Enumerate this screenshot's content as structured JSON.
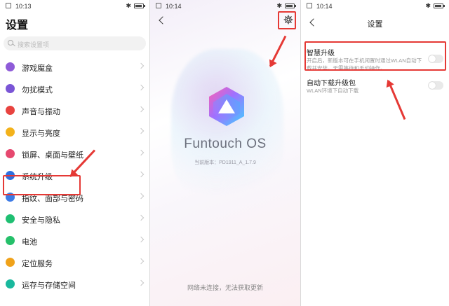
{
  "panel1": {
    "status_time": "10:13",
    "title": "设置",
    "search_placeholder": "搜索设置项",
    "items": [
      {
        "label": "游戏魔盒",
        "icon": "gamepad-icon",
        "color": "#8e5bd8"
      },
      {
        "label": "勿扰模式",
        "icon": "moon-icon",
        "color": "#7a55d6"
      },
      {
        "label": "声音与振动",
        "icon": "speaker-icon",
        "color": "#e8433f"
      },
      {
        "label": "显示与亮度",
        "icon": "sun-icon",
        "color": "#f3b21b"
      },
      {
        "label": "锁屏、桌面与壁纸",
        "icon": "shirt-icon",
        "color": "#e6486f"
      },
      {
        "label": "系统升级",
        "icon": "upgrade-icon",
        "color": "#2f6fe0"
      },
      {
        "label": "指纹、面部与密码",
        "icon": "fingerprint-icon",
        "color": "#3d7be6"
      },
      {
        "label": "安全与隐私",
        "icon": "shield-icon",
        "color": "#1fbf72"
      },
      {
        "label": "电池",
        "icon": "battery-icon",
        "color": "#25c06a"
      },
      {
        "label": "定位服务",
        "icon": "location-pin-icon",
        "color": "#f0a21a"
      },
      {
        "label": "运存与存储空间",
        "icon": "storage-icon",
        "color": "#19b89d"
      }
    ]
  },
  "panel2": {
    "status_time": "10:14",
    "brand": "Funtouch OS",
    "version": "当前版本：PD1911_A_1.7.9",
    "network_message": "网络未连接，无法获取更新"
  },
  "panel3": {
    "status_time": "10:14",
    "title": "设置",
    "options": [
      {
        "title": "智慧升级",
        "desc": "开启后，新版本可在手机闲置时通过WLAN自动下载并安装，无需等待和手动操作。",
        "enabled": false
      },
      {
        "title": "自动下载升级包",
        "desc": "WLAN环境下自动下载",
        "enabled": false
      }
    ]
  },
  "colors": {
    "highlight_red": "#e53935",
    "brand_text": "#6b6f7c"
  }
}
